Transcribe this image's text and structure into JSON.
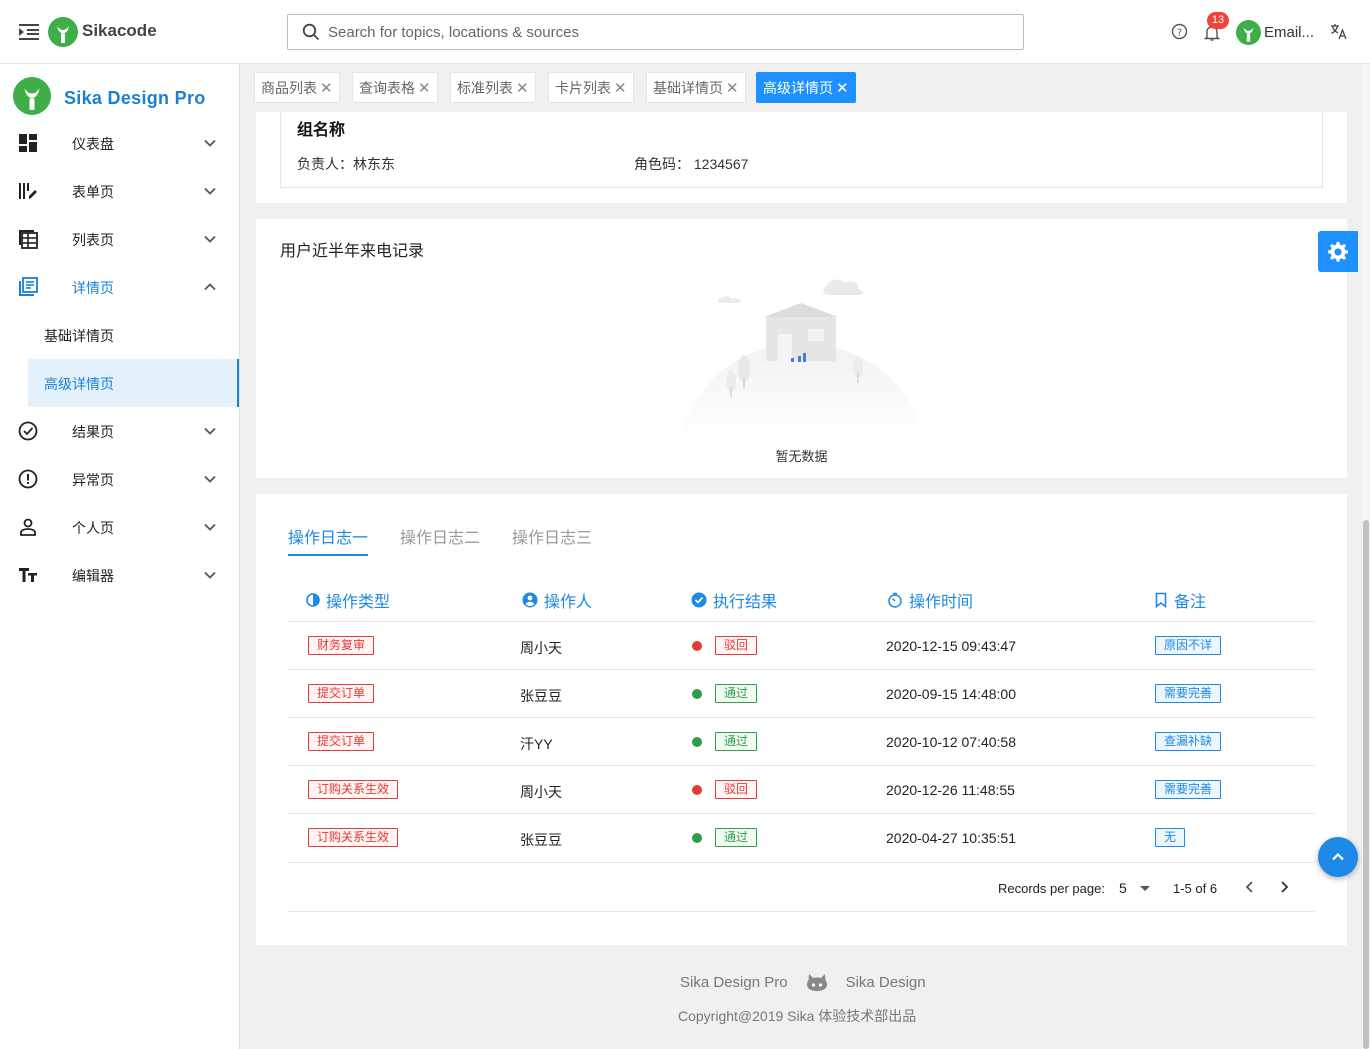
{
  "header": {
    "brand": "Sikacode",
    "search_placeholder": "Search for topics, locations & sources",
    "notification_count": "13",
    "user_label": "Email..."
  },
  "sidebar": {
    "title": "Sika Design Pro",
    "items": [
      {
        "label": "仪表盘",
        "icon": "dashboard-icon"
      },
      {
        "label": "表单页",
        "icon": "form-icon"
      },
      {
        "label": "列表页",
        "icon": "list-icon"
      },
      {
        "label": "详情页",
        "icon": "detail-icon",
        "expanded": true
      },
      {
        "label": "结果页",
        "icon": "check-circle-icon"
      },
      {
        "label": "异常页",
        "icon": "alert-circle-icon"
      },
      {
        "label": "个人页",
        "icon": "person-icon"
      },
      {
        "label": "编辑器",
        "icon": "text-format-icon"
      }
    ],
    "sub_items": [
      {
        "label": "基础详情页"
      },
      {
        "label": "高级详情页",
        "selected": true
      }
    ]
  },
  "tabs": [
    {
      "label": "商品列表"
    },
    {
      "label": "查询表格"
    },
    {
      "label": "标准列表"
    },
    {
      "label": "卡片列表"
    },
    {
      "label": "基础详情页"
    },
    {
      "label": "高级详情页",
      "active": true
    }
  ],
  "group": {
    "title": "组名称",
    "owner_label": "负责人：",
    "owner_value": "林东东",
    "role_label": "角色码：",
    "role_value": "1234567"
  },
  "call_records": {
    "title": "用户近半年来电记录",
    "empty_text": "暂无数据"
  },
  "logs": {
    "tabs": [
      "操作日志一",
      "操作日志二",
      "操作日志三"
    ],
    "active_tab": 0,
    "columns": [
      "操作类型",
      "操作人",
      "执行结果",
      "操作时间",
      "备注"
    ],
    "rows": [
      {
        "type": "财务复审",
        "operator": "周小天",
        "result": "驳回",
        "status": "rejected",
        "time": "2020-12-15 09:43:47",
        "note": "原因不详"
      },
      {
        "type": "提交订单",
        "operator": "张豆豆",
        "result": "通过",
        "status": "passed",
        "time": "2020-09-15 14:48:00",
        "note": "需要完善"
      },
      {
        "type": "提交订单",
        "operator": "汗YY",
        "result": "通过",
        "status": "passed",
        "time": "2020-10-12 07:40:58",
        "note": "查漏补缺"
      },
      {
        "type": "订购关系生效",
        "operator": "周小天",
        "result": "驳回",
        "status": "rejected",
        "time": "2020-12-26 11:48:55",
        "note": "需要完善"
      },
      {
        "type": "订购关系生效",
        "operator": "张豆豆",
        "result": "通过",
        "status": "passed",
        "time": "2020-04-27 10:35:51",
        "note": "无"
      }
    ],
    "pagination": {
      "rows_per_page_label": "Records per page:",
      "rows_per_page": "5",
      "range": "1-5 of 6"
    }
  },
  "footer": {
    "link1": "Sika Design Pro",
    "link2": "Sika Design",
    "copyright": "Copyright@2019 Sika 体验技术部出品"
  },
  "colors": {
    "primary": "#1e88e5",
    "reject": "#e53935",
    "pass": "#2e9e44"
  }
}
